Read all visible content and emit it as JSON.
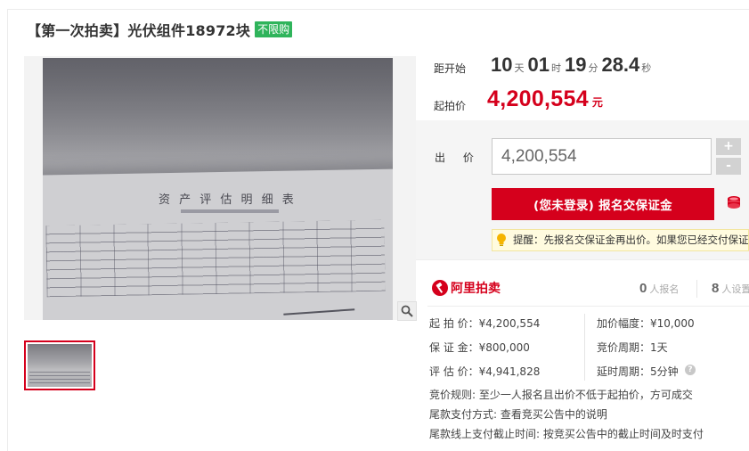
{
  "title": "【第一次拍卖】光伏组件18972块",
  "badge": "不限购",
  "countdown": {
    "label": "距开始",
    "days": "10",
    "days_unit": "天",
    "hours": "01",
    "hours_unit": "时",
    "minutes": "19",
    "minutes_unit": "分",
    "seconds": "28.4",
    "seconds_unit": "秒"
  },
  "start_price": {
    "label": "起拍价",
    "amount": "4,200,554",
    "unit": "元"
  },
  "bid": {
    "label": "出 价",
    "value": "4,200,554",
    "plus": "+",
    "minus": "-",
    "signup_button": "(您未登录) 报名交保证金",
    "tip": "提醒：先报名交保证金再出价。如果您已经交付保证金"
  },
  "stats": {
    "signups": "0",
    "signups_label": "人报名",
    "reminders": "8",
    "reminders_label": "人设置提醒"
  },
  "logo": {
    "text": "阿里拍卖"
  },
  "details": {
    "start_price": "起 拍 价：¥4,200,554",
    "increment": "加价幅度：¥10,000",
    "deposit": "保 证 金：¥800,000",
    "bid_cycle": "竞价周期：1天",
    "appraisal": "评 估 价：¥4,941,828",
    "delay_cycle": "延时周期：5分钟",
    "rule": "竞价规则:   至少一人报名且出价不低于起拍价，方可成交",
    "payment_method": "尾款支付方式:   查看竞买公告中的说明",
    "payment_deadline": "尾款线上支付截止时间:   按竞买公告中的截止时间及时支付"
  },
  "photo": {
    "document_title": "资 产 评 估 明 细 表"
  },
  "colors": {
    "accent": "#d5001c",
    "badge_green": "#2fb45b",
    "tip_bg": "#fffbdf"
  },
  "icons": [
    "zoom-icon",
    "coin-stack-icon",
    "lightbulb-icon",
    "help-icon",
    "alipai-logo-icon"
  ]
}
